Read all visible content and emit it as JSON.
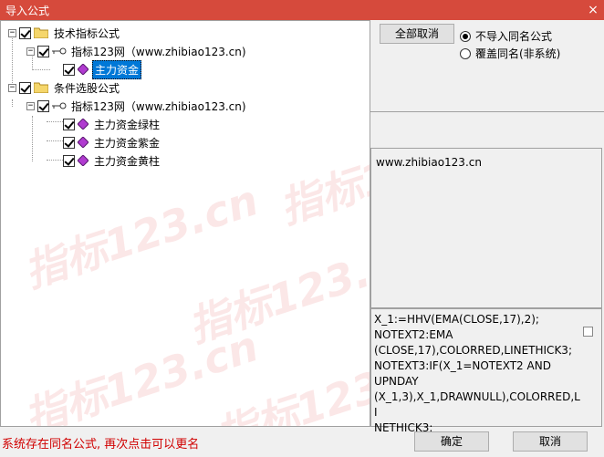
{
  "window": {
    "title": "导入公式",
    "close_glyph": "×"
  },
  "tree": {
    "nodes": [
      {
        "label": "技术指标公式",
        "toggle": "−"
      },
      {
        "label": "指标123网（www.zhibiao123.cn)",
        "toggle": "−"
      },
      {
        "label": "主力资金",
        "selected": true
      },
      {
        "label": "条件选股公式",
        "toggle": "−"
      },
      {
        "label": "指标123网（www.zhibiao123.cn)",
        "toggle": "−"
      },
      {
        "label": "主力资金绿柱"
      },
      {
        "label": "主力资金紫金"
      },
      {
        "label": "主力资金黄柱"
      }
    ]
  },
  "right": {
    "deselect_all_label": "全部取消",
    "options": [
      {
        "label": "不导入同名公式",
        "checked": true
      },
      {
        "label": "覆盖同名(非系统)",
        "checked": false
      }
    ],
    "url_text": "www.zhibiao123.cn",
    "code_text": "X_1:=HHV(EMA(CLOSE,17),2);\nNOTEXT2:EMA\n(CLOSE,17),COLORRED,LINETHICK3;\nNOTEXT3:IF(X_1=NOTEXT2 AND\nUPNDAY\n(X_1,3),X_1,DRAWNULL),COLORRED,LI\nNETHICK3;"
  },
  "status_text": "系统存在同名公式, 再次点击可以更名",
  "buttons": {
    "ok": "确定",
    "cancel": "取消"
  },
  "watermark_text": "指标123.cn",
  "colors": {
    "titlebar": "#d64a3c",
    "status": "#d00000",
    "selection": "#0078d7"
  }
}
